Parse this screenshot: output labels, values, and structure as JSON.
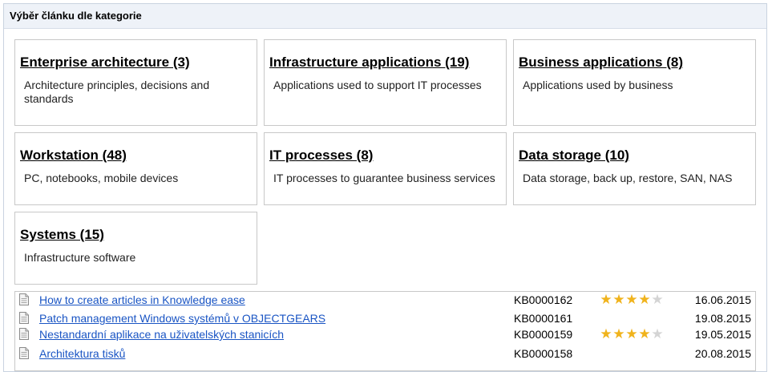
{
  "panel": {
    "title": "Výběr článku dle kategorie"
  },
  "categories": [
    {
      "title": "Enterprise architecture (3)",
      "desc": "Architecture principles, decisions and standards"
    },
    {
      "title": "Infrastructure applications (19)",
      "desc": "Applications used to support IT processes"
    },
    {
      "title": "Business applications (8)",
      "desc": "Applications used by business"
    },
    {
      "title": "Workstation (48)",
      "desc": "PC, notebooks, mobile devices"
    },
    {
      "title": "IT processes (8)",
      "desc": "IT processes to guarantee business services"
    },
    {
      "title": "Data storage (10)",
      "desc": "Data storage, back up, restore, SAN, NAS"
    },
    {
      "title": "Systems (15)",
      "desc": "Infrastructure software"
    }
  ],
  "articles": [
    {
      "title": "How to create articles in Knowledge ease",
      "id": "KB0000162",
      "rating": 4,
      "date": "16.06.2015"
    },
    {
      "title": "Patch management Windows systémů v OBJECTGEARS",
      "id": "KB0000161",
      "rating": 0,
      "date": "19.08.2015"
    },
    {
      "title": "Nestandardní aplikace na uživatelských stanicích",
      "id": "KB0000159",
      "rating": 4,
      "date": "19.05.2015"
    },
    {
      "title": "Architektura tisků",
      "id": "KB0000158",
      "rating": 0,
      "date": "20.08.2015"
    }
  ],
  "colors": {
    "link": "#1a55c4",
    "star_on": "#f0b31c",
    "star_off": "#d4d4d4",
    "header_bg": "#eef2f8"
  },
  "icons": {
    "article": "document-icon",
    "rating": "star-icon"
  }
}
